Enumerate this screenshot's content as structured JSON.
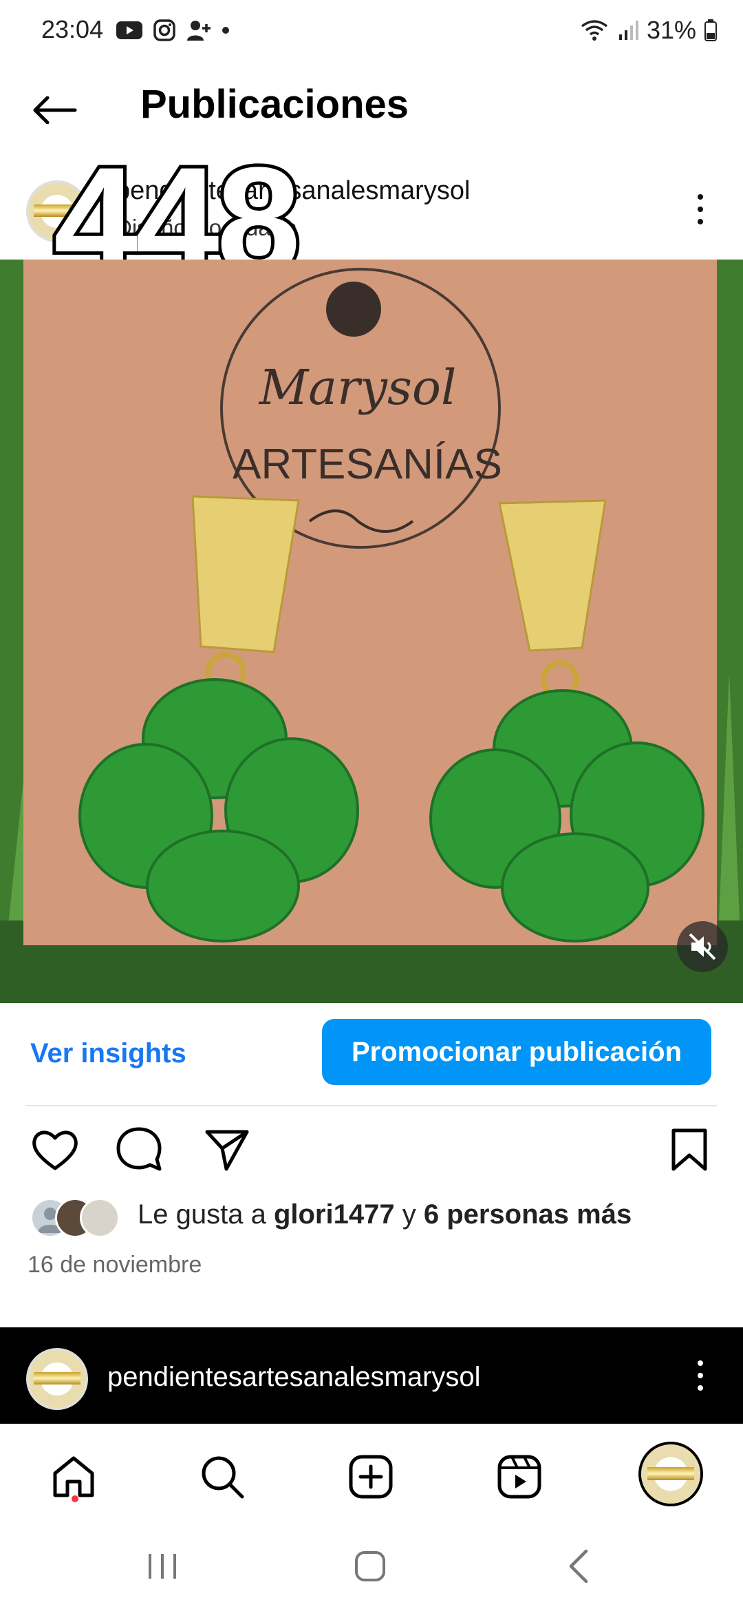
{
  "status": {
    "time": "23:04",
    "battery": "31%",
    "icons_left": [
      "youtube-icon",
      "instagram-icon",
      "person-add-icon",
      "dot-icon"
    ],
    "icons_right": [
      "wifi-icon",
      "signal-icon",
      "battery-icon"
    ]
  },
  "header": {
    "title": "Publicaciones"
  },
  "post": {
    "username": "pendientesartesanalesmarysol",
    "location": "Diseño Nocudaría",
    "counter_overlay": "448",
    "image": {
      "card_text_line1": "Marysol",
      "card_text_line2": "ARTESANÍAS"
    },
    "insights_label": "Ver insights",
    "promote_label": "Promocionar publicación",
    "likes": {
      "prefix": "Le gusta a ",
      "user": "glori1477",
      "middle": " y ",
      "others": "6 personas más"
    },
    "date": "16 de noviembre"
  },
  "next_post": {
    "username": "pendientesartesanalesmarysol"
  },
  "colors": {
    "accent": "#0095f6",
    "link": "#1877f2",
    "notification_dot": "#ff3040"
  }
}
